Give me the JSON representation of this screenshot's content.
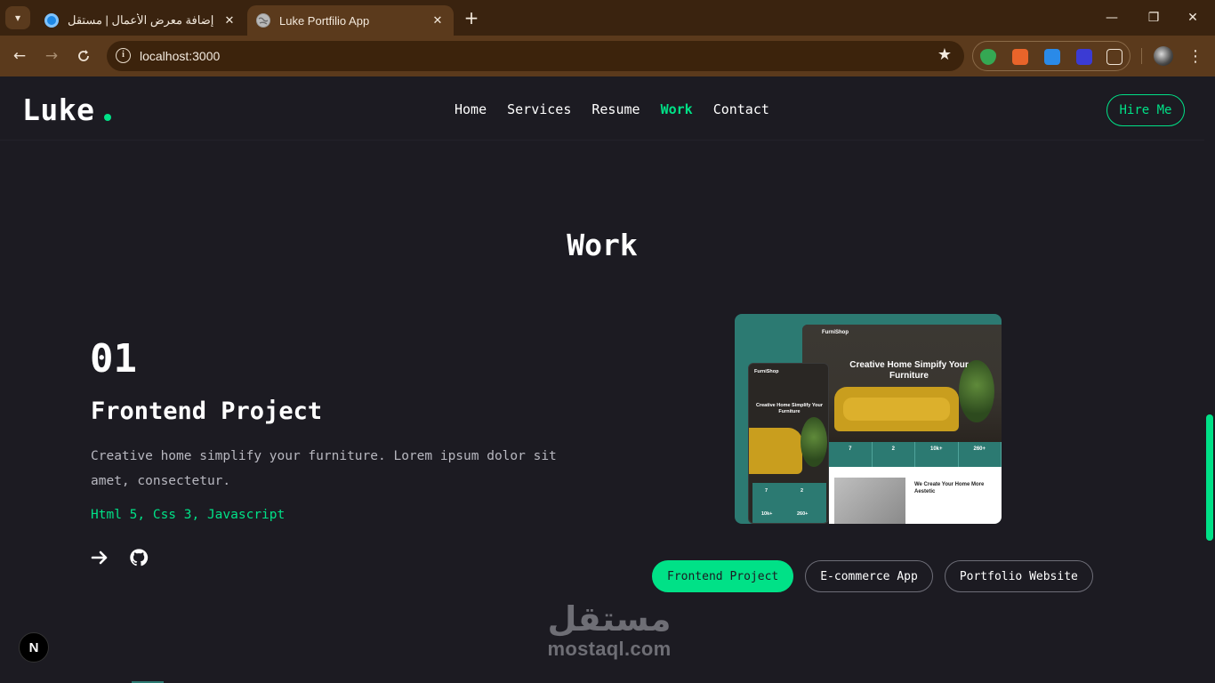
{
  "browser": {
    "tabs": [
      {
        "title": "إضافة معرض الأعمال | مستقل",
        "close": "✕"
      },
      {
        "title": "Luke Portfilio App",
        "close": "✕"
      }
    ],
    "new_tab": "+",
    "url": "localhost:3000",
    "window_controls": {
      "minimize": "—",
      "restore": "❐",
      "close": "✕"
    }
  },
  "site": {
    "logo": "Luke",
    "accent": "#00e187",
    "background": "#1c1b22",
    "nav": [
      {
        "label": "Home",
        "active": false
      },
      {
        "label": "Services",
        "active": false
      },
      {
        "label": "Resume",
        "active": false
      },
      {
        "label": "Work",
        "active": true
      },
      {
        "label": "Contact",
        "active": false
      }
    ],
    "hire_label": "Hire Me"
  },
  "work": {
    "section_title": "Work",
    "number": "01",
    "title": "Frontend Project",
    "description": "Creative home simplify your furniture. Lorem ipsum dolor sit amet, consectetur.",
    "stack": "Html 5, Css 3, Javascript",
    "icons": [
      "arrow-right-icon",
      "github-icon"
    ],
    "preview": {
      "brand": "FurniShop",
      "hero_title": "Creative Home Simpify Your Furniture",
      "mobile_title": "Creative Home Simplify Your Furniture",
      "stats": [
        "7",
        "2",
        "10k+",
        "260+"
      ],
      "section_title": "We Create Your Home More Aestetic"
    },
    "filters": [
      {
        "label": "Frontend Project",
        "active": true
      },
      {
        "label": "E-commerce App",
        "active": false
      },
      {
        "label": "Portfolio Website",
        "active": false
      }
    ]
  },
  "dev_badge": "N",
  "watermark": {
    "arabic": "مستقل",
    "latin": "mostaql.com"
  }
}
